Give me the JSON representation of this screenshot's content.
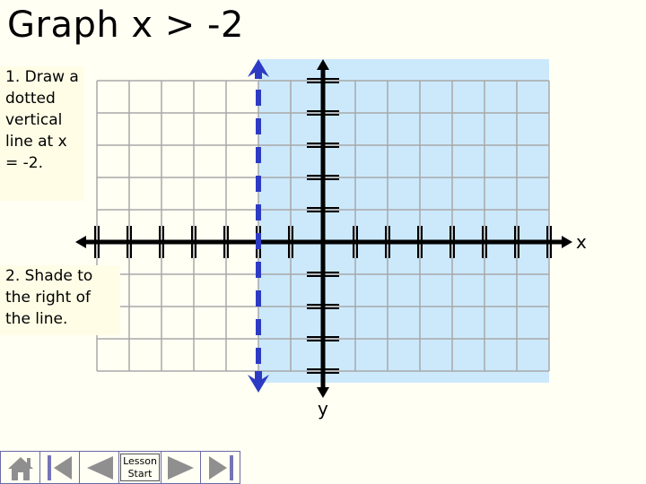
{
  "title": "Graph x > -2",
  "instructions": [
    "1. Draw a dotted vertical line at x = -2.",
    "2. Shade to the right of the line."
  ],
  "graph": {
    "x_axis_label": "x",
    "y_axis_label": "y",
    "x_range": [
      -7,
      7
    ],
    "y_range": [
      -4,
      5
    ],
    "boundary_x": -2,
    "boundary_style": "dashed",
    "shaded_side": "right",
    "colors": {
      "shade": "#cce9fc",
      "boundary": "#2d3bc4",
      "grid": "#a8a8a8",
      "axis": "#000000"
    }
  },
  "nav": {
    "home_icon": "home-icon",
    "first_icon": "first-slide-icon",
    "prev_icon": "previous-slide-icon",
    "lesson_start_line1": "Lesson",
    "lesson_start_line2": "Start",
    "next_icon": "next-slide-icon",
    "last_icon": "last-slide-icon",
    "icon_color": "#8f8f8f",
    "bar_color": "#7474b8"
  }
}
